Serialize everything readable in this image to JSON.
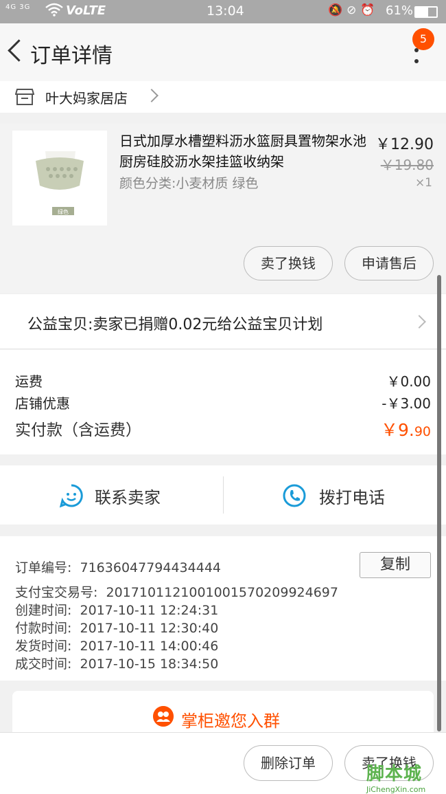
{
  "status_bar": {
    "signal": "4G 3G",
    "volte": "VoLTE",
    "time": "13:04",
    "battery": "61%"
  },
  "header": {
    "title": "订单详情",
    "badge_count": "5"
  },
  "shop": {
    "name": "叶大妈家居店"
  },
  "product": {
    "name": "日式加厚水槽塑料沥水篮厨具置物架水池厨房硅胶沥水架挂篮收纳架",
    "variant": "颜色分类:小麦材质 绿色",
    "price": "￥12.90",
    "original_price": "￥19.80",
    "quantity": "×1",
    "thumb_tag": "绿色",
    "buttons": {
      "sell": "卖了换钱",
      "after_sale": "申请售后"
    }
  },
  "charity": {
    "text": "公益宝贝:卖家已捐赠0.02元给公益宝贝计划"
  },
  "fees": {
    "shipping_label": "运费",
    "shipping_value": "￥0.00",
    "discount_label": "店铺优惠",
    "discount_value": "-￥3.00",
    "total_label": "实付款（含运费）",
    "total_value_main": "￥9.",
    "total_value_cents": "90"
  },
  "contact": {
    "seller": "联系卖家",
    "phone": "拨打电话"
  },
  "order_info": {
    "order_no_label": "订单编号:",
    "order_no": "71636047794434444",
    "copy_button": "复制",
    "alipay_label": "支付宝交易号:",
    "alipay_no": "2017101121001001570209924697",
    "created_label": "创建时间:",
    "created": "2017-10-11  12:24:31",
    "paid_label": "付款时间:",
    "paid": "2017-10-11  12:30:40",
    "shipped_label": "发货时间:",
    "shipped": "2017-10-11  14:00:46",
    "closed_label": "成交时间:",
    "closed": "2017-10-15  18:34:50"
  },
  "invite": {
    "text": "掌柜邀您入群"
  },
  "bottom_bar": {
    "delete": "删除订单",
    "sell": "卖了换钱"
  },
  "watermark": {
    "brand": "脚本城",
    "site": "JiChengXin.com"
  },
  "colors": {
    "accent": "#ff5000",
    "contact_blue": "#1a9bd8"
  }
}
